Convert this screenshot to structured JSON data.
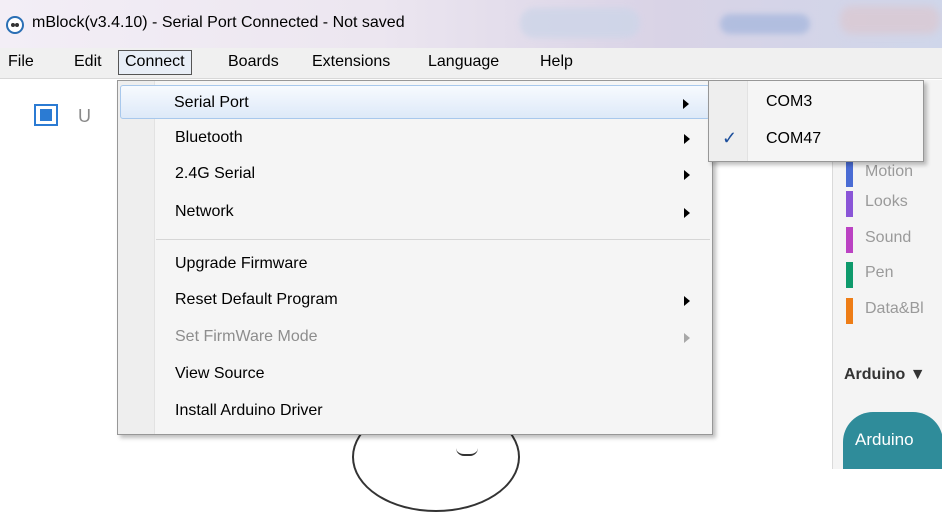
{
  "window": {
    "title": "mBlock(v3.4.10) - Serial Port Connected - Not saved"
  },
  "menubar": {
    "items": [
      "File",
      "Edit",
      "Connect",
      "Boards",
      "Extensions",
      "Language",
      "Help"
    ]
  },
  "toolbar": {
    "partial_label": "U"
  },
  "connect_menu": {
    "items": [
      {
        "label": "Serial Port",
        "submenu": true,
        "highlighted": true
      },
      {
        "label": "Bluetooth",
        "submenu": true
      },
      {
        "label": "2.4G Serial",
        "submenu": true
      },
      {
        "label": "Network",
        "submenu": true
      },
      {
        "label": "Upgrade Firmware",
        "submenu": false
      },
      {
        "label": "Reset Default Program",
        "submenu": true
      },
      {
        "label": "Set FirmWare Mode",
        "submenu": true,
        "disabled": true
      },
      {
        "label": "View Source",
        "submenu": false
      },
      {
        "label": "Install Arduino Driver",
        "submenu": false
      }
    ]
  },
  "serial_port_submenu": {
    "items": [
      {
        "label": "COM3",
        "checked": false
      },
      {
        "label": "COM47",
        "checked": true
      }
    ]
  },
  "categories": [
    {
      "label": "Motion",
      "color": "#4a6cd4"
    },
    {
      "label": "Looks",
      "color": "#8a55d7"
    },
    {
      "label": "Sound",
      "color": "#bb42c3"
    },
    {
      "label": "Pen",
      "color": "#0e9a6c"
    },
    {
      "label": "Data&Bl",
      "color": "#ee7d16"
    }
  ],
  "blocks_panel": {
    "dropdown_label": "Arduino ▼",
    "block_label": "Arduino"
  },
  "colors": {
    "menu_highlight": "#dde9f8",
    "check_color": "#1d4f9c",
    "accent": "#2b7bd3"
  }
}
